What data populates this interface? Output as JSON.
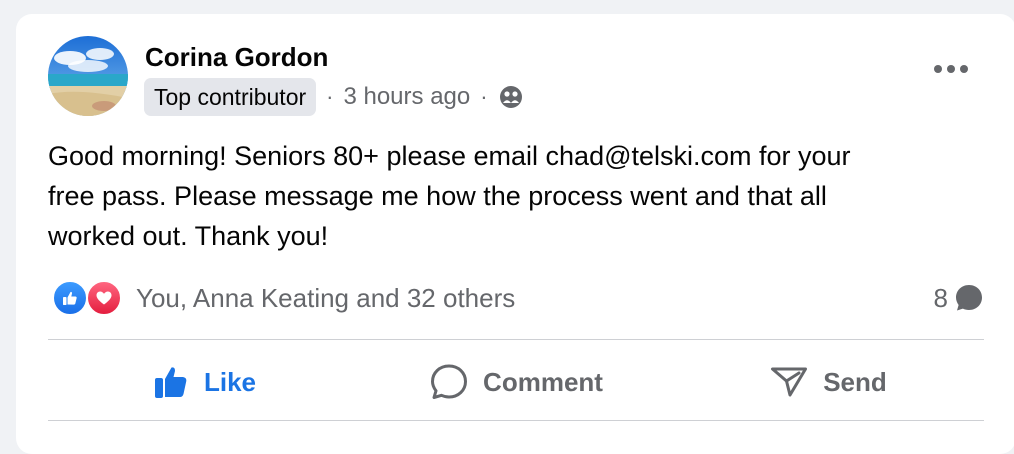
{
  "post": {
    "author": "Corina Gordon",
    "badge": "Top contributor",
    "separator": "·",
    "time": "3 hours ago",
    "audience_icon": "friends-icon",
    "more_icon": "more-dots-icon",
    "text_lines": [
      "Good morning!  Seniors 80+ please email chad@telski.com for your",
      "free pass.  Please message me how the process went and that all",
      "worked out.  Thank you!"
    ]
  },
  "reactions": {
    "icons": [
      "like-reaction-icon",
      "love-reaction-icon"
    ],
    "summary": "You, Anna Keating and 32 others",
    "comment_count": "8"
  },
  "actions": {
    "like": "Like",
    "comment": "Comment",
    "send": "Send"
  },
  "colors": {
    "accent": "#1b74e4",
    "secondary_text": "#65676b",
    "badge_bg": "#e4e6eb",
    "love": "#e41e3f"
  }
}
